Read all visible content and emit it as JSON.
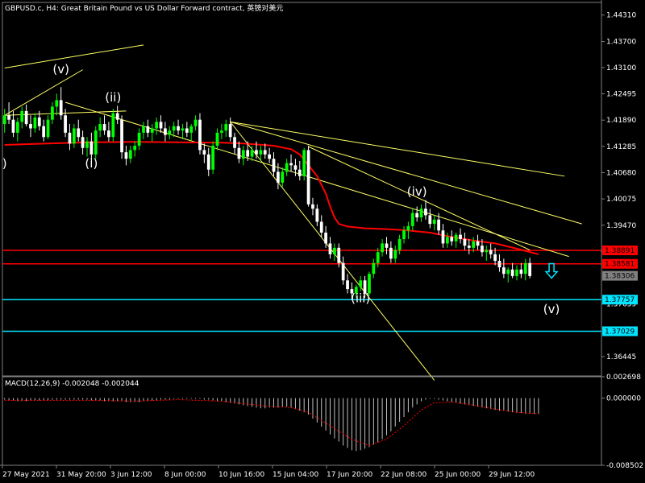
{
  "window": {
    "title": "GBPUSD.c, H4:  Great Britain Pound vs US Dollar Forward contract, 英镑对美元"
  },
  "colors": {
    "background": "#000000",
    "bull_candle": "#00ff00",
    "bear_candle": "#ffffff",
    "moving_average": "#ff0000",
    "trendline": "#ffff66",
    "support_line": "#00e5ff",
    "resistance_line": "#ff0000",
    "macd_hist": "#c0c0c0",
    "macd_signal": "#ff0000",
    "text": "#ffffff"
  },
  "chart_data": {
    "type": "candlestick",
    "symbol": "GBPUSD.c",
    "timeframe": "H4",
    "ylim": [
      1.36,
      1.446
    ],
    "y_ticks": [
      "1.44310",
      "1.43700",
      "1.43100",
      "1.42495",
      "1.41890",
      "1.41285",
      "1.40680",
      "1.40075",
      "1.39470",
      "1.38865",
      "1.37659",
      "1.36445"
    ],
    "x_ticks": [
      "27 May 2021",
      "31 May 20:00",
      "3 Jun 12:00",
      "8 Jun 00:00",
      "10 Jun 16:00",
      "15 Jun 04:00",
      "17 Jun 20:00",
      "22 Jun 08:00",
      "25 Jun 00:00",
      "29 Jun 12:00"
    ],
    "wave_labels": [
      {
        "text": "(v)",
        "bar": 13,
        "price": 1.4297
      },
      {
        "text": "(ii)",
        "bar": 25,
        "price": 1.4232
      },
      {
        "text": ")",
        "bar": 0,
        "price": 1.408
      },
      {
        "text": "(i)",
        "bar": 20,
        "price": 1.408
      },
      {
        "text": "(iv)",
        "bar": 95,
        "price": 1.4015
      },
      {
        "text": "(iii)",
        "bar": 82,
        "price": 1.377
      },
      {
        "text": "(v)",
        "bar": 126,
        "price": 1.3745
      }
    ],
    "price_tags": [
      {
        "label": "1.38891",
        "price": 1.38891,
        "color": "#ff0000"
      },
      {
        "label": "1.38581",
        "price": 1.38581,
        "color": "#ff0000"
      },
      {
        "label": "1.38306",
        "price": 1.38306,
        "color": "#808080"
      },
      {
        "label": "1.37757",
        "price": 1.37757,
        "color": "#00e5ff"
      },
      {
        "label": "1.37029",
        "price": 1.37029,
        "color": "#00e5ff"
      }
    ],
    "horizontal_lines": [
      {
        "price": 1.38891,
        "color": "#ff0000"
      },
      {
        "price": 1.38581,
        "color": "#ff0000"
      },
      {
        "price": 1.37757,
        "color": "#00e5ff"
      },
      {
        "price": 1.37029,
        "color": "#00e5ff"
      }
    ],
    "trendlines": [
      {
        "from": {
          "bar": 0,
          "price": 1.4309
        },
        "to": {
          "bar": 32,
          "price": 1.4362
        }
      },
      {
        "from": {
          "bar": 0,
          "price": 1.42
        },
        "to": {
          "bar": 18,
          "price": 1.4305
        }
      },
      {
        "from": {
          "bar": 0,
          "price": 1.42
        },
        "to": {
          "bar": 28,
          "price": 1.421
        }
      },
      {
        "from": {
          "bar": 14,
          "price": 1.423
        },
        "to": {
          "bar": 130,
          "price": 1.3875
        }
      },
      {
        "from": {
          "bar": 52,
          "price": 1.4185
        },
        "to": {
          "bar": 129,
          "price": 1.406
        }
      },
      {
        "from": {
          "bar": 52,
          "price": 1.4185
        },
        "to": {
          "bar": 133,
          "price": 1.395
        }
      },
      {
        "from": {
          "bar": 52,
          "price": 1.4185
        },
        "to": {
          "bar": 99,
          "price": 1.359
        }
      },
      {
        "from": {
          "bar": 70,
          "price": 1.4128
        },
        "to": {
          "bar": 121,
          "price": 1.389
        }
      }
    ],
    "arrow": {
      "bar": 126,
      "price": 1.384,
      "color": "#00e5ff"
    },
    "candles": [
      [
        1.418,
        1.4215,
        1.416,
        1.42
      ],
      [
        1.42,
        1.423,
        1.418,
        1.419
      ],
      [
        1.419,
        1.421,
        1.415,
        1.416
      ],
      [
        1.416,
        1.4195,
        1.414,
        1.4185
      ],
      [
        1.4185,
        1.422,
        1.417,
        1.421
      ],
      [
        1.421,
        1.4225,
        1.4175,
        1.418
      ],
      [
        1.418,
        1.42,
        1.415,
        1.417
      ],
      [
        1.417,
        1.4205,
        1.416,
        1.4195
      ],
      [
        1.4195,
        1.421,
        1.4165,
        1.4175
      ],
      [
        1.4175,
        1.419,
        1.414,
        1.415
      ],
      [
        1.415,
        1.42,
        1.4145,
        1.419
      ],
      [
        1.419,
        1.423,
        1.418,
        1.422
      ],
      [
        1.422,
        1.425,
        1.42,
        1.4235
      ],
      [
        1.4235,
        1.4265,
        1.419,
        1.42
      ],
      [
        1.42,
        1.4215,
        1.415,
        1.416
      ],
      [
        1.416,
        1.418,
        1.412,
        1.4135
      ],
      [
        1.4135,
        1.418,
        1.4125,
        1.417
      ],
      [
        1.417,
        1.419,
        1.414,
        1.415
      ],
      [
        1.415,
        1.4165,
        1.411,
        1.4125
      ],
      [
        1.4125,
        1.415,
        1.4105,
        1.414
      ],
      [
        1.414,
        1.416,
        1.4095,
        1.411
      ],
      [
        1.411,
        1.4175,
        1.41,
        1.4165
      ],
      [
        1.4165,
        1.4195,
        1.415,
        1.418
      ],
      [
        1.418,
        1.42,
        1.4155,
        1.4165
      ],
      [
        1.4165,
        1.4185,
        1.414,
        1.415
      ],
      [
        1.415,
        1.4215,
        1.414,
        1.4205
      ],
      [
        1.4205,
        1.4222,
        1.418,
        1.419
      ],
      [
        1.419,
        1.42,
        1.41,
        1.4115
      ],
      [
        1.4115,
        1.413,
        1.4085,
        1.41
      ],
      [
        1.41,
        1.413,
        1.409,
        1.412
      ],
      [
        1.412,
        1.414,
        1.4105,
        1.413
      ],
      [
        1.413,
        1.417,
        1.412,
        1.416
      ],
      [
        1.416,
        1.4185,
        1.4145,
        1.4175
      ],
      [
        1.4175,
        1.419,
        1.415,
        1.416
      ],
      [
        1.416,
        1.418,
        1.414,
        1.417
      ],
      [
        1.417,
        1.4195,
        1.4155,
        1.4185
      ],
      [
        1.4185,
        1.42,
        1.416,
        1.417
      ],
      [
        1.417,
        1.4185,
        1.414,
        1.4155
      ],
      [
        1.4155,
        1.4175,
        1.4145,
        1.4165
      ],
      [
        1.4165,
        1.4185,
        1.415,
        1.4175
      ],
      [
        1.4175,
        1.419,
        1.4155,
        1.4165
      ],
      [
        1.4165,
        1.418,
        1.4145,
        1.417
      ],
      [
        1.417,
        1.4185,
        1.415,
        1.416
      ],
      [
        1.416,
        1.418,
        1.414,
        1.4175
      ],
      [
        1.4175,
        1.42,
        1.4165,
        1.419
      ],
      [
        1.419,
        1.4205,
        1.411,
        1.412
      ],
      [
        1.412,
        1.4135,
        1.409,
        1.411
      ],
      [
        1.411,
        1.4125,
        1.406,
        1.4075
      ],
      [
        1.4075,
        1.414,
        1.4065,
        1.413
      ],
      [
        1.413,
        1.417,
        1.412,
        1.416
      ],
      [
        1.416,
        1.418,
        1.4145,
        1.4165
      ],
      [
        1.4165,
        1.419,
        1.415,
        1.418
      ],
      [
        1.418,
        1.4195,
        1.414,
        1.415
      ],
      [
        1.415,
        1.416,
        1.411,
        1.4125
      ],
      [
        1.4125,
        1.414,
        1.409,
        1.41
      ],
      [
        1.41,
        1.413,
        1.4085,
        1.412
      ],
      [
        1.412,
        1.414,
        1.4095,
        1.4105
      ],
      [
        1.4105,
        1.413,
        1.4095,
        1.412
      ],
      [
        1.412,
        1.414,
        1.41,
        1.411
      ],
      [
        1.411,
        1.413,
        1.4095,
        1.412
      ],
      [
        1.412,
        1.4135,
        1.41,
        1.411
      ],
      [
        1.411,
        1.4125,
        1.409,
        1.41
      ],
      [
        1.41,
        1.4115,
        1.406,
        1.407
      ],
      [
        1.407,
        1.409,
        1.403,
        1.4045
      ],
      [
        1.4045,
        1.408,
        1.4035,
        1.407
      ],
      [
        1.407,
        1.41,
        1.406,
        1.409
      ],
      [
        1.409,
        1.411,
        1.407,
        1.4085
      ],
      [
        1.4085,
        1.41,
        1.406,
        1.4075
      ],
      [
        1.4075,
        1.4095,
        1.405,
        1.406
      ],
      [
        1.406,
        1.4125,
        1.405,
        1.412
      ],
      [
        1.412,
        1.413,
        1.399,
        1.3995
      ],
      [
        1.3995,
        1.401,
        1.397,
        1.3985
      ],
      [
        1.3985,
        1.3995,
        1.3945,
        1.3955
      ],
      [
        1.3955,
        1.397,
        1.392,
        1.393
      ],
      [
        1.393,
        1.3945,
        1.3895,
        1.3905
      ],
      [
        1.3905,
        1.392,
        1.387,
        1.388
      ],
      [
        1.388,
        1.3905,
        1.3865,
        1.3895
      ],
      [
        1.3895,
        1.3905,
        1.385,
        1.386
      ],
      [
        1.386,
        1.3875,
        1.381,
        1.382
      ],
      [
        1.382,
        1.3835,
        1.379,
        1.38
      ],
      [
        1.38,
        1.3815,
        1.3775,
        1.379
      ],
      [
        1.379,
        1.381,
        1.378,
        1.3805
      ],
      [
        1.3805,
        1.383,
        1.3795,
        1.382
      ],
      [
        1.382,
        1.383,
        1.378,
        1.379
      ],
      [
        1.379,
        1.384,
        1.3785,
        1.3835
      ],
      [
        1.3835,
        1.387,
        1.3825,
        1.386
      ],
      [
        1.386,
        1.3895,
        1.385,
        1.3885
      ],
      [
        1.3885,
        1.3915,
        1.3875,
        1.3905
      ],
      [
        1.3905,
        1.392,
        1.388,
        1.3895
      ],
      [
        1.3895,
        1.391,
        1.386,
        1.387
      ],
      [
        1.387,
        1.39,
        1.386,
        1.389
      ],
      [
        1.389,
        1.3925,
        1.388,
        1.3915
      ],
      [
        1.3915,
        1.3945,
        1.3905,
        1.3935
      ],
      [
        1.3935,
        1.3955,
        1.3915,
        1.3945
      ],
      [
        1.3945,
        1.3985,
        1.3935,
        1.3975
      ],
      [
        1.3975,
        1.399,
        1.3955,
        1.3965
      ],
      [
        1.3965,
        1.3995,
        1.3955,
        1.3985
      ],
      [
        1.3985,
        1.4005,
        1.396,
        1.397
      ],
      [
        1.397,
        1.3985,
        1.394,
        1.395
      ],
      [
        1.395,
        1.397,
        1.3935,
        1.396
      ],
      [
        1.396,
        1.3975,
        1.3925,
        1.3935
      ],
      [
        1.3935,
        1.395,
        1.3895,
        1.3905
      ],
      [
        1.3905,
        1.393,
        1.3895,
        1.392
      ],
      [
        1.392,
        1.3935,
        1.39,
        1.391
      ],
      [
        1.391,
        1.393,
        1.3895,
        1.3925
      ],
      [
        1.3925,
        1.394,
        1.3905,
        1.3915
      ],
      [
        1.3915,
        1.393,
        1.389,
        1.39
      ],
      [
        1.39,
        1.3915,
        1.388,
        1.3895
      ],
      [
        1.3895,
        1.392,
        1.3885,
        1.391
      ],
      [
        1.391,
        1.3925,
        1.389,
        1.39
      ],
      [
        1.39,
        1.3915,
        1.3875,
        1.3885
      ],
      [
        1.3885,
        1.39,
        1.3865,
        1.389
      ],
      [
        1.389,
        1.3905,
        1.387,
        1.388
      ],
      [
        1.388,
        1.3895,
        1.3855,
        1.3865
      ],
      [
        1.3865,
        1.388,
        1.384,
        1.385
      ],
      [
        1.385,
        1.387,
        1.3825,
        1.3835
      ],
      [
        1.3835,
        1.385,
        1.3815,
        1.3845
      ],
      [
        1.3845,
        1.386,
        1.3825,
        1.383
      ],
      [
        1.383,
        1.3855,
        1.382,
        1.3845
      ],
      [
        1.3845,
        1.386,
        1.3825,
        1.3835
      ],
      [
        1.3835,
        1.387,
        1.382,
        1.386
      ],
      [
        1.386,
        1.3872,
        1.3825,
        1.383
      ]
    ],
    "ma": [
      [
        0,
        1.4132
      ],
      [
        10,
        1.4135
      ],
      [
        20,
        1.4138
      ],
      [
        30,
        1.4139
      ],
      [
        40,
        1.4138
      ],
      [
        50,
        1.4137
      ],
      [
        55,
        1.4135
      ],
      [
        62,
        1.413
      ],
      [
        66,
        1.4122
      ],
      [
        68,
        1.411
      ],
      [
        70,
        1.4085
      ],
      [
        72,
        1.406
      ],
      [
        74,
        1.402
      ],
      [
        75,
        1.399
      ],
      [
        76,
        1.3965
      ],
      [
        77,
        1.395
      ],
      [
        79,
        1.3944
      ],
      [
        83,
        1.394
      ],
      [
        88,
        1.3938
      ],
      [
        93,
        1.3935
      ],
      [
        98,
        1.393
      ],
      [
        103,
        1.392
      ],
      [
        108,
        1.3912
      ],
      [
        113,
        1.3905
      ],
      [
        118,
        1.3893
      ],
      [
        123,
        1.388
      ]
    ],
    "macd": {
      "title": "MACD(12,26,9) -0.002048 -0.002044",
      "ylim": [
        -0.008502,
        0.002698
      ],
      "y_ticks": [
        "0.002698",
        "0.000000",
        "-0.008502"
      ],
      "histogram": [
        -0.0002,
        -0.0003,
        -0.0003,
        -0.0004,
        -0.0004,
        -0.0004,
        -0.0003,
        -0.0003,
        -0.0003,
        -0.0003,
        -0.0003,
        -0.0002,
        -0.0002,
        -0.0002,
        -0.0002,
        -0.0002,
        -0.0002,
        -0.0002,
        -0.0002,
        -0.0002,
        -0.0003,
        -0.0003,
        -0.0003,
        -0.0004,
        -0.0004,
        -0.0004,
        -0.0004,
        -0.0004,
        -0.0005,
        -0.0005,
        -0.0005,
        -0.0005,
        -0.0004,
        -0.0004,
        -0.0003,
        -0.0003,
        -0.0002,
        -0.0002,
        -0.0002,
        -0.0001,
        -0.0001,
        -0.0001,
        -0.0001,
        -0.0001,
        -0.0001,
        -0.0001,
        -0.0002,
        -0.0002,
        -0.0003,
        -0.0004,
        -0.0004,
        -0.0005,
        -0.0006,
        -0.0007,
        -0.0008,
        -0.0009,
        -0.001,
        -0.0011,
        -0.0012,
        -0.0013,
        -0.0013,
        -0.0012,
        -0.0012,
        -0.0012,
        -0.0011,
        -0.0011,
        -0.0012,
        -0.0014,
        -0.0016,
        -0.0018,
        -0.0021,
        -0.0026,
        -0.0031,
        -0.0036,
        -0.0041,
        -0.0046,
        -0.0051,
        -0.0055,
        -0.006,
        -0.0063,
        -0.0066,
        -0.0067,
        -0.0066,
        -0.0064,
        -0.0062,
        -0.0059,
        -0.0056,
        -0.0052,
        -0.0047,
        -0.0042,
        -0.0036,
        -0.003,
        -0.0024,
        -0.0018,
        -0.0012,
        -0.0008,
        -0.0004,
        -0.0002,
        -0.0001,
        -0.0001,
        -0.0002,
        -0.0003,
        -0.0004,
        -0.0005,
        -0.0006,
        -0.0007,
        -0.0008,
        -0.0009,
        -0.001,
        -0.0011,
        -0.0012,
        -0.0013,
        -0.0014,
        -0.0015,
        -0.0016,
        -0.0016,
        -0.0017,
        -0.0018,
        -0.0019,
        -0.0019,
        -0.002,
        -0.002,
        -0.002,
        -0.002
      ],
      "signal": [
        [
          0,
          -0.0003
        ],
        [
          10,
          -0.0003
        ],
        [
          20,
          -0.0003
        ],
        [
          30,
          -0.0004
        ],
        [
          40,
          -0.0002
        ],
        [
          50,
          -0.0004
        ],
        [
          60,
          -0.001
        ],
        [
          66,
          -0.0012
        ],
        [
          70,
          -0.0018
        ],
        [
          75,
          -0.0035
        ],
        [
          80,
          -0.0052
        ],
        [
          84,
          -0.006
        ],
        [
          88,
          -0.0052
        ],
        [
          92,
          -0.0035
        ],
        [
          96,
          -0.0015
        ],
        [
          99,
          -0.0006
        ],
        [
          103,
          -0.0005
        ],
        [
          108,
          -0.0009
        ],
        [
          113,
          -0.0014
        ],
        [
          118,
          -0.0018
        ],
        [
          123,
          -0.002
        ]
      ]
    }
  }
}
